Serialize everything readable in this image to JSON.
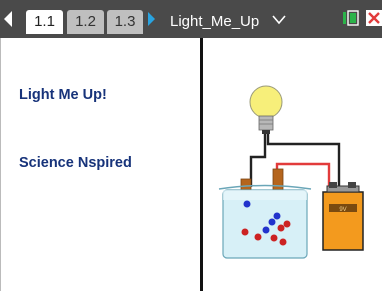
{
  "toolbar": {
    "tabs": [
      {
        "label": "1.1",
        "active": true
      },
      {
        "label": "1.2",
        "active": false
      },
      {
        "label": "1.3",
        "active": false
      }
    ],
    "document_title": "Light_Me_Up",
    "icons": [
      "prev-tab-icon",
      "next-tab-icon",
      "dropdown-icon",
      "battery-icon",
      "close-icon"
    ],
    "colors": {
      "bar": "#4a4a4a",
      "next_arrow": "#29a3e0",
      "battery": "#2bb34a",
      "close": "#e23b3b"
    }
  },
  "left_pane": {
    "title": "Light Me Up!",
    "subtitle": "Science Nspired",
    "text_color": "#17337a"
  },
  "right_pane": {
    "illustration": "lightbulb-circuit-beaker",
    "battery_label": "9V"
  }
}
